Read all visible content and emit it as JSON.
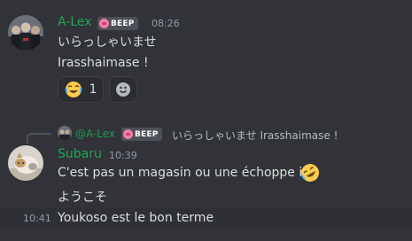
{
  "colors": {
    "background": "#313338",
    "username_alex": "#23a55a",
    "username_subaru": "#23a55a",
    "badge_bg": "#4e5058",
    "text": "#dbdee1",
    "muted": "#949ba4"
  },
  "message1": {
    "username": "A-Lex",
    "badge": "BEEP",
    "timestamp": "08:26",
    "lines": [
      "いらっしゃいませ",
      "Irasshaimase !"
    ],
    "reactions": [
      {
        "icon": "joy-emoji-icon",
        "count": "1"
      },
      {
        "icon": "add-reaction-icon",
        "count": ""
      }
    ]
  },
  "reply": {
    "username": "@A-Lex",
    "badge": "BEEP",
    "text": "いらっしゃいませ Irasshaimase !"
  },
  "message2": {
    "username": "Subaru",
    "timestamp": "10:39",
    "lines": [
      "C'est pas un magasin ou une échoppe ici",
      "ようこそ"
    ],
    "trailing_emoji": "rofl-emoji-icon"
  },
  "message3": {
    "timestamp": "10:41",
    "text": "Youkoso est le bon terme"
  }
}
